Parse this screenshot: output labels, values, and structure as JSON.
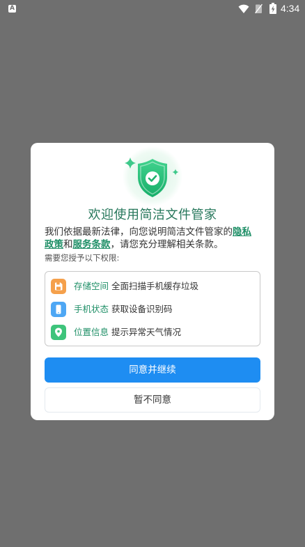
{
  "status_bar": {
    "notification_icon": "app-notification-icon",
    "notification_letter": "A",
    "wifi_icon": "wifi-icon",
    "sim_icon": "no-sim-icon",
    "battery_icon": "battery-charging-icon",
    "time": "4:34"
  },
  "dialog": {
    "illustration_icon": "shield-check-icon",
    "title": "欢迎使用简洁文件管家",
    "intro": {
      "text_before": "我们依据最新法律，向您说明简洁文件管家的",
      "privacy_link": "隐私政策",
      "connector": "和",
      "terms_link": "服务条款",
      "text_after": "，请您充分理解相关条款。"
    },
    "permissions_heading": "需要您授予以下权限:",
    "permissions": [
      {
        "icon": "storage-icon",
        "icon_color": "#f5a04b",
        "name": "存储空间",
        "description": "全面扫描手机缓存垃圾"
      },
      {
        "icon": "phone-icon",
        "icon_color": "#4ea7f4",
        "name": "手机状态",
        "description": "获取设备识别码"
      },
      {
        "icon": "location-icon",
        "icon_color": "#3ec47b",
        "name": "位置信息",
        "description": "提示异常天气情况"
      }
    ],
    "agree_button": "同意并继续",
    "decline_button": "暂不同意"
  },
  "colors": {
    "screen_dim": "#6f6f6f",
    "dialog_background": "#ffffff",
    "title_green": "#26775b",
    "accent_green": "#1f8f67",
    "primary_blue": "#1e8df2",
    "body_text": "#333333",
    "secondary_text": "#555555"
  }
}
